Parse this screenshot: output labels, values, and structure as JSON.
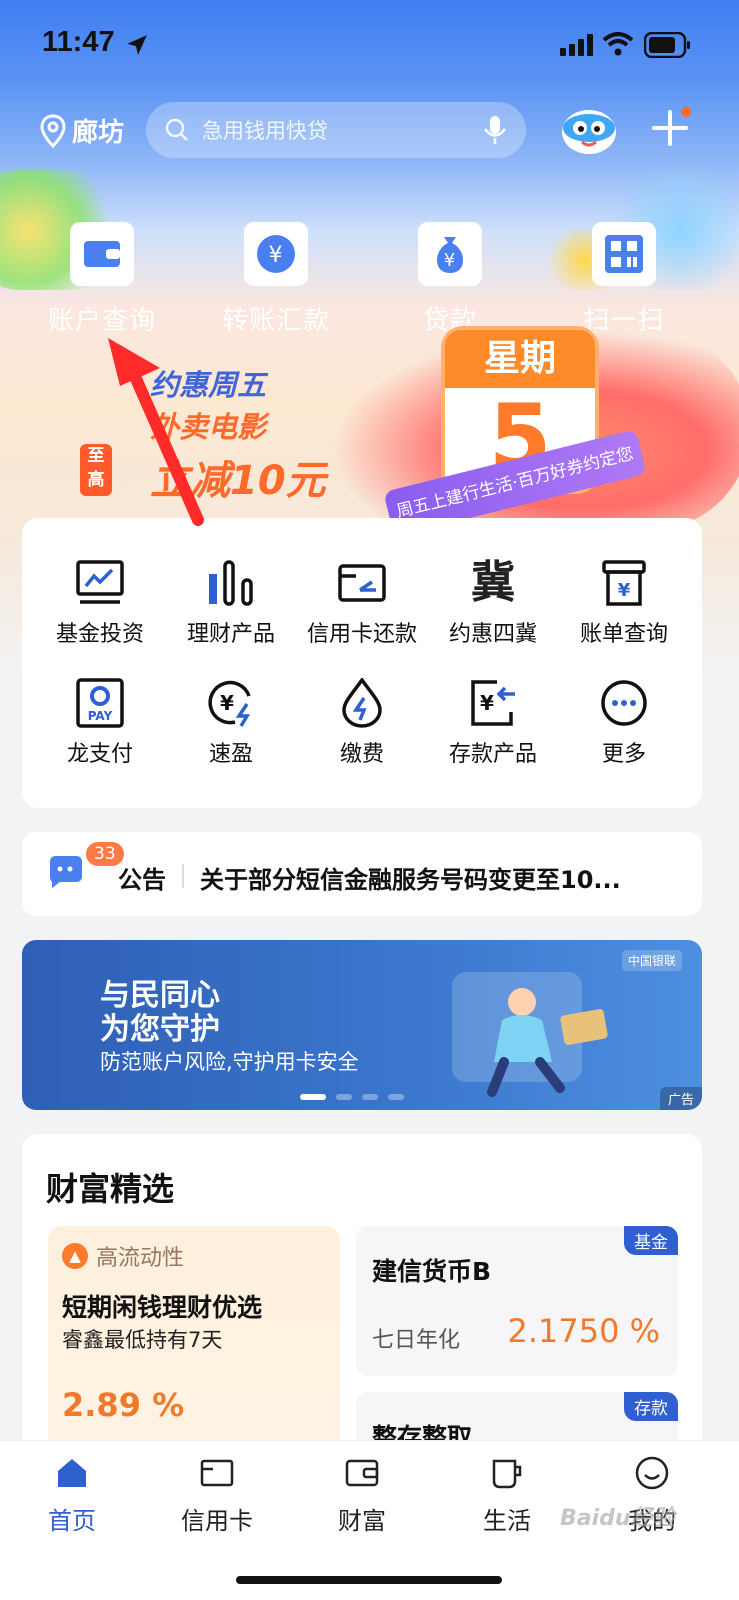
{
  "status_bar": {
    "time": "11:47"
  },
  "header": {
    "location": "廊坊",
    "search_placeholder": "急用钱用快贷"
  },
  "quick_actions": [
    {
      "label": "账户查询",
      "icon": "wallet-icon"
    },
    {
      "label": "转账汇款",
      "icon": "transfer-icon"
    },
    {
      "label": "贷款",
      "icon": "money-bag-icon"
    },
    {
      "label": "扫一扫",
      "icon": "scan-icon"
    }
  ],
  "promo": {
    "line1": "约惠周五",
    "line2": "外卖电影",
    "badge": "至高",
    "line3": "立减10元",
    "calendar_head": "星期",
    "calendar_num": "5",
    "ribbon": "周五上建行生活·百万好券约定您"
  },
  "services": [
    {
      "label": "基金投资",
      "icon": "chart-icon"
    },
    {
      "label": "理财产品",
      "icon": "bars-icon"
    },
    {
      "label": "信用卡还款",
      "icon": "card-repay-icon"
    },
    {
      "label": "约惠四冀",
      "icon": "ji-icon",
      "glyph": "冀"
    },
    {
      "label": "账单查询",
      "icon": "bill-icon"
    },
    {
      "label": "龙支付",
      "icon": "pay-icon"
    },
    {
      "label": "速盈",
      "icon": "speed-yuan-icon"
    },
    {
      "label": "缴费",
      "icon": "drop-bolt-icon"
    },
    {
      "label": "存款产品",
      "icon": "deposit-icon"
    },
    {
      "label": "更多",
      "icon": "more-icon"
    }
  ],
  "notice": {
    "badge": "33",
    "label": "公告",
    "text": "关于部分短信金融服务号码变更至10..."
  },
  "banner": {
    "line1": "与民同心",
    "line2": "为您守护",
    "line3": "防范账户风险,守护用卡安全",
    "brand": "中国银联",
    "ad": "广告"
  },
  "wealth": {
    "title": "财富精选",
    "left": {
      "tag": "高流动性",
      "title": "短期闲钱理财优选",
      "subtitle": "睿鑫最低持有7天",
      "rate": "2.89 %"
    },
    "right": [
      {
        "corner": "基金",
        "title": "建信货币B",
        "key": "七日年化",
        "value": "2.1750 %"
      },
      {
        "corner": "存款",
        "title": "整存整取"
      }
    ]
  },
  "tabs": [
    {
      "label": "首页",
      "icon": "home-icon",
      "active": true
    },
    {
      "label": "信用卡",
      "icon": "credit-card-icon"
    },
    {
      "label": "财富",
      "icon": "wallet-tab-icon"
    },
    {
      "label": "生活",
      "icon": "cup-icon"
    },
    {
      "label": "我的",
      "icon": "smile-icon"
    }
  ],
  "watermark": "Baidu经验",
  "colors": {
    "primary": "#2f5fd0",
    "accent": "#f07a2a",
    "annotation": "#ff2a2a"
  }
}
